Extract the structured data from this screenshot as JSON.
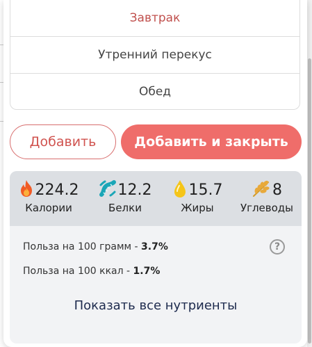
{
  "meals": [
    {
      "label": "Завтрак",
      "selected": true
    },
    {
      "label": "Утренний перекус",
      "selected": false
    },
    {
      "label": "Обед",
      "selected": false
    }
  ],
  "actions": {
    "add_label": "Добавить",
    "add_close_label": "Добавить и закрыть"
  },
  "macros": [
    {
      "icon": "fire-icon",
      "value": "224.2",
      "label": "Калории"
    },
    {
      "icon": "protein-helix-icon",
      "value": "12.2",
      "label": "Белки"
    },
    {
      "icon": "fat-drop-icon",
      "value": "15.7",
      "label": "Жиры"
    },
    {
      "icon": "wheat-icon",
      "value": "8",
      "label": "Углеводы"
    }
  ],
  "benefit": {
    "per100g_label": "Польза на 100 грамм - ",
    "per100g_value": "3.7%",
    "per100kcal_label": "Польза на 100 ккал - ",
    "per100kcal_value": "1.7%",
    "help_symbol": "?"
  },
  "show_all_label": "Показать все нутриенты",
  "colors": {
    "accent": "#ef6d6a",
    "selected_text": "#c0504d",
    "panel_bg": "#f2f3f5",
    "macro_bar_bg": "#dcdfe3"
  }
}
